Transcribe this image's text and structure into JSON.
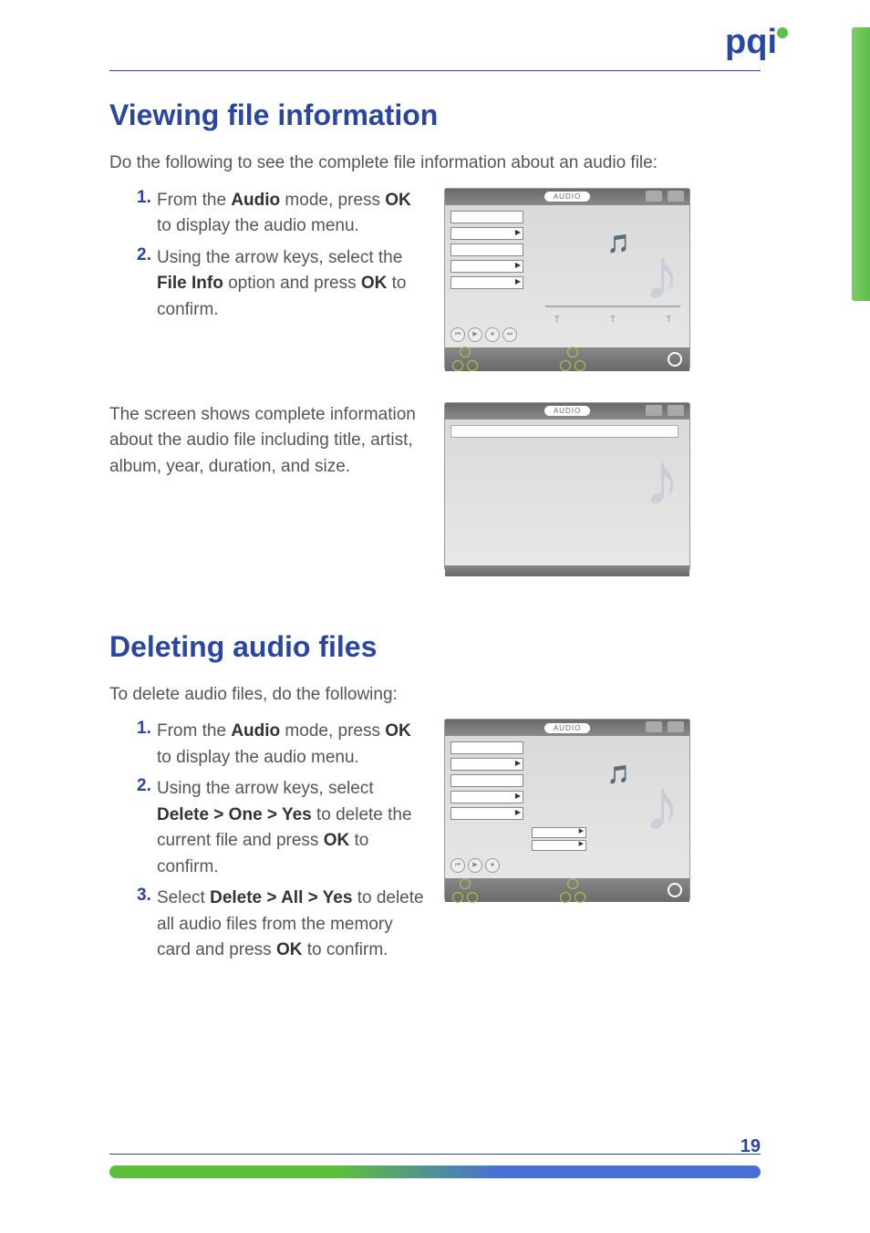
{
  "logo": "pqi",
  "page_number": "19",
  "section1": {
    "heading": "Viewing file information",
    "intro": "Do the following to see the complete file information about an audio file:",
    "steps": [
      {
        "num": "1.",
        "text_before": "From the ",
        "bold1": "Audio",
        "text_mid1": " mode, press ",
        "bold2": "OK",
        "text_after": " to display the audio menu."
      },
      {
        "num": "2.",
        "text_before": "Using the arrow keys, select the ",
        "bold1": "File Info",
        "text_mid1": " option and press ",
        "bold2": "OK",
        "text_after": " to confirm."
      }
    ],
    "paragraph2": "The screen shows complete information about the audio file including title, artist, album, year, duration, and size."
  },
  "section2": {
    "heading": "Deleting audio files",
    "intro": "To delete audio files, do the following:",
    "steps": [
      {
        "num": "1.",
        "text_before": "From the ",
        "bold1": "Audio",
        "text_mid1": " mode, press ",
        "bold2": "OK",
        "text_after": " to display the audio menu."
      },
      {
        "num": "2.",
        "text_before": "Using the arrow keys, select ",
        "bold1": "Delete > One > Yes",
        "text_mid1": " to delete the current file and press ",
        "bold2": "OK",
        "text_after": " to confirm."
      },
      {
        "num": "3.",
        "text_before": "Select ",
        "bold1": "Delete > All > Yes",
        "text_mid1": " to delete all audio files from the memory card and press ",
        "bold2": "OK",
        "text_after": " to confirm."
      }
    ]
  },
  "screen": {
    "audio_label": "AUDIO",
    "tick": "T"
  }
}
